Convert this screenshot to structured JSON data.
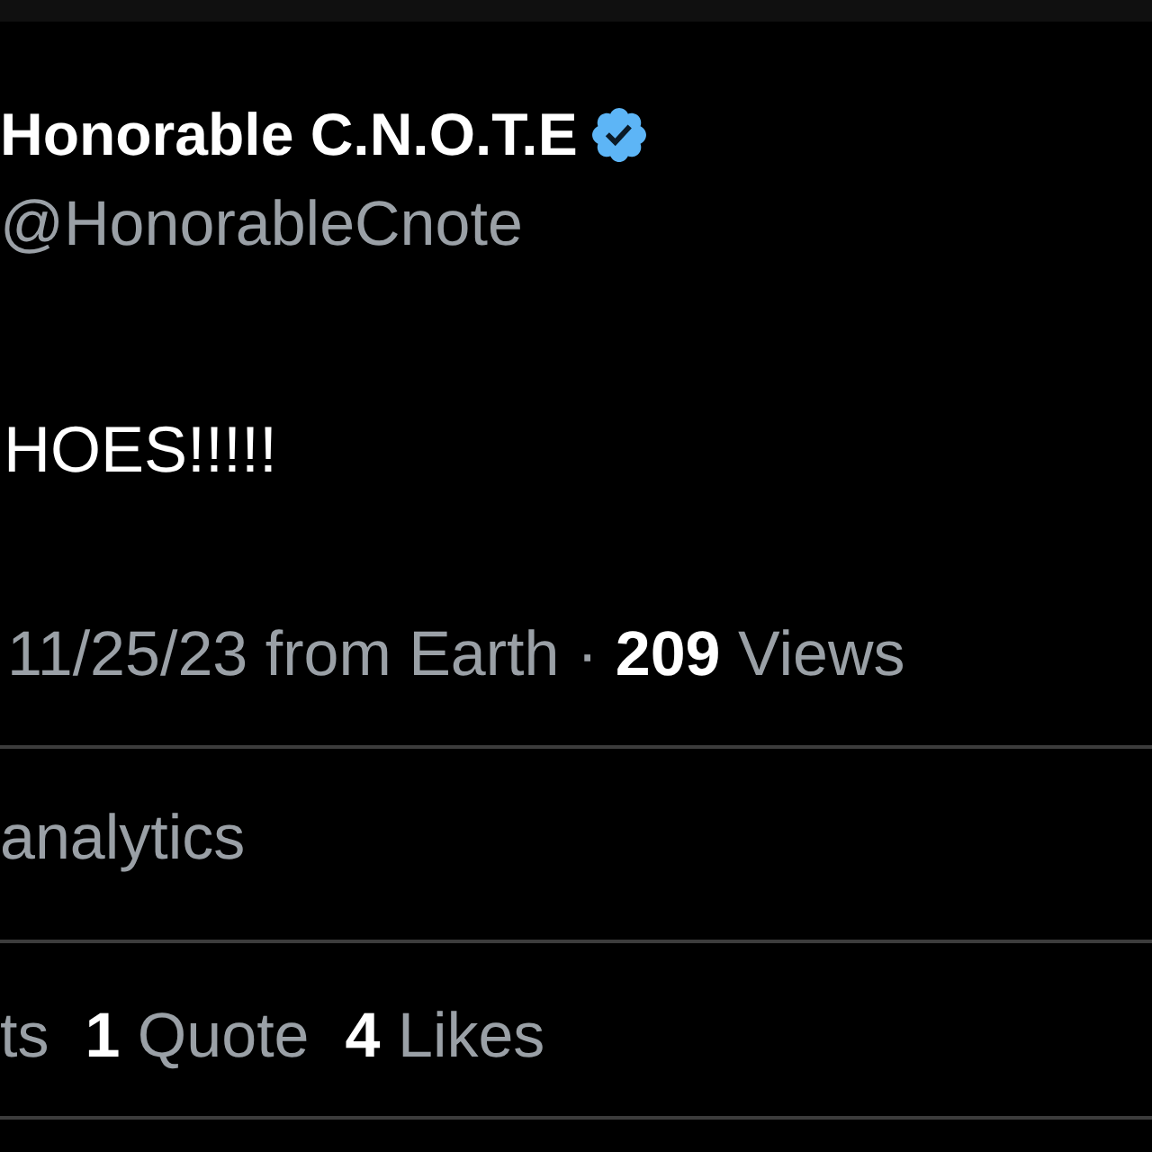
{
  "author": {
    "name": "Honorable C.N.O.T.E",
    "verified": true,
    "handle": "@HonorableCnote"
  },
  "post_text": "HOES!!!!!",
  "meta": "11/25/23 from Earth · **209** Views",
  "analytics_link": "analytics",
  "stats": [
    {
      "text": "ts"
    },
    {
      "text": "**1** Quote"
    },
    {
      "text": "**4** Likes"
    }
  ]
}
